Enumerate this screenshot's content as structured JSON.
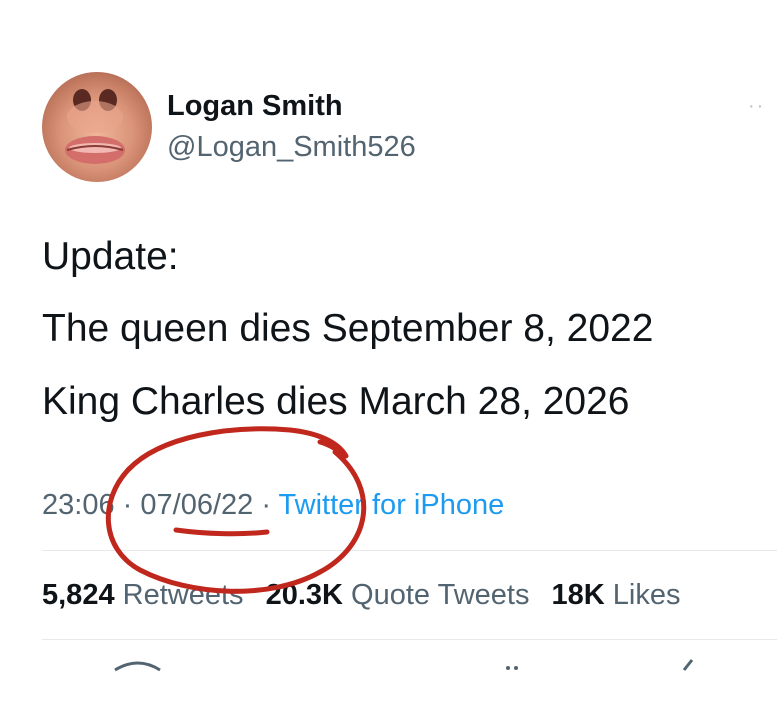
{
  "author": {
    "name": "Logan Smith",
    "handle": "@Logan_Smith526"
  },
  "menu_icon": "more-dots-icon",
  "tweet": {
    "lines": [
      "Update:",
      "The queen dies September 8, 2022",
      "King Charles dies March 28, 2026"
    ]
  },
  "meta": {
    "time": "23:06",
    "separator": "·",
    "date": "07/06/22",
    "source": "Twitter for iPhone"
  },
  "stats": {
    "retweets_count": "5,824",
    "retweets_label": "Retweets",
    "quotes_count": "20.3K",
    "quotes_label": "Quote Tweets",
    "likes_count": "18K",
    "likes_label": "Likes"
  },
  "colors": {
    "text": "#0f1419",
    "secondary": "#536471",
    "link": "#1d9bf0",
    "annotation": "#c0271d"
  }
}
